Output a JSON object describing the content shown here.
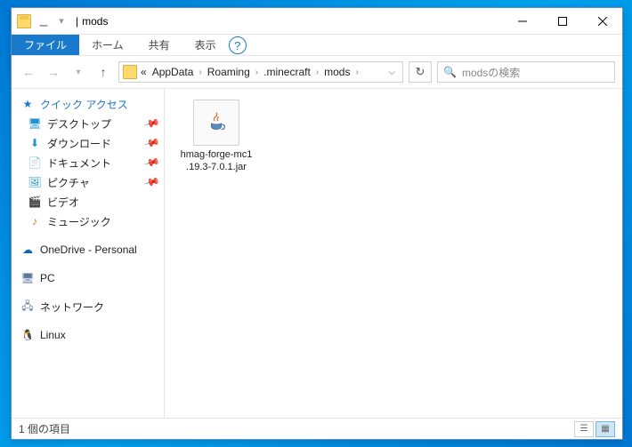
{
  "title": "mods",
  "titlebar_sep": "|",
  "ribbon": {
    "file": "ファイル",
    "home": "ホーム",
    "share": "共有",
    "view": "表示"
  },
  "breadcrumb": {
    "lead": "«",
    "items": [
      "AppData",
      "Roaming",
      ".minecraft",
      "mods"
    ]
  },
  "search_placeholder": "modsの検索",
  "sidebar": {
    "quick_access": "クイック アクセス",
    "desktop": "デスクトップ",
    "downloads": "ダウンロード",
    "documents": "ドキュメント",
    "pictures": "ピクチャ",
    "videos": "ビデオ",
    "music": "ミュージック",
    "onedrive": "OneDrive - Personal",
    "pc": "PC",
    "network": "ネットワーク",
    "linux": "Linux"
  },
  "files": [
    {
      "name_line1": "hmag-forge-mc1",
      "name_line2": ".19.3-7.0.1.jar"
    }
  ],
  "status": "1 個の項目"
}
